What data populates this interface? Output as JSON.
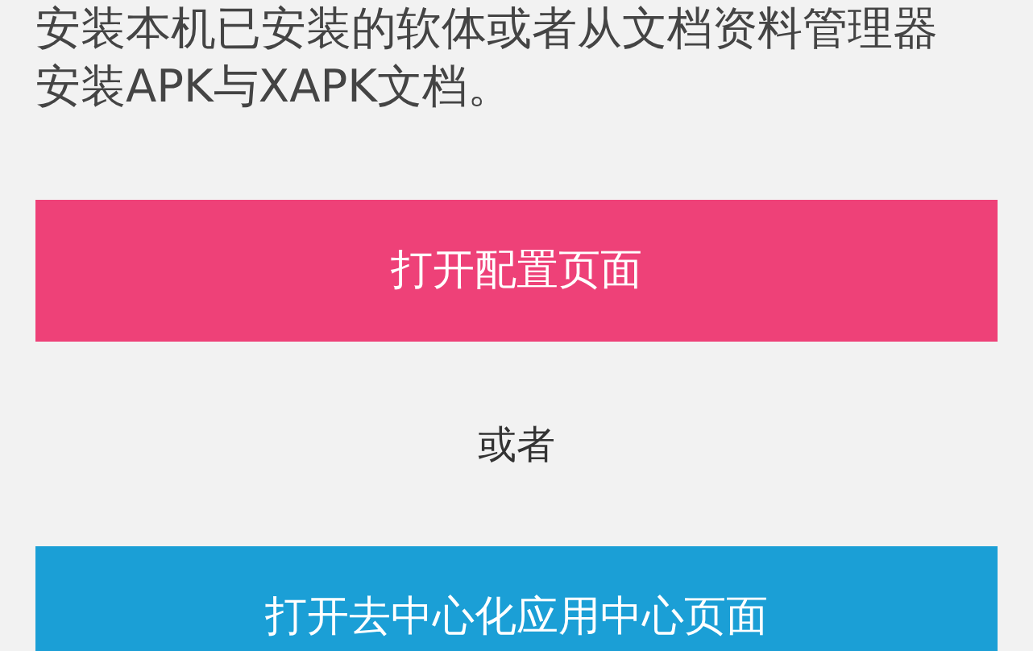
{
  "intro": [
    "安装本机已安装的软体或者从文档资料管理器",
    "安装APK与XAPK文档。"
  ],
  "buttons": [
    {
      "label": "打开配置页面",
      "kind": "primary"
    },
    {
      "label": "打开去中心化应用中心页面",
      "kind": "secondary"
    }
  ],
  "separator": "或者"
}
